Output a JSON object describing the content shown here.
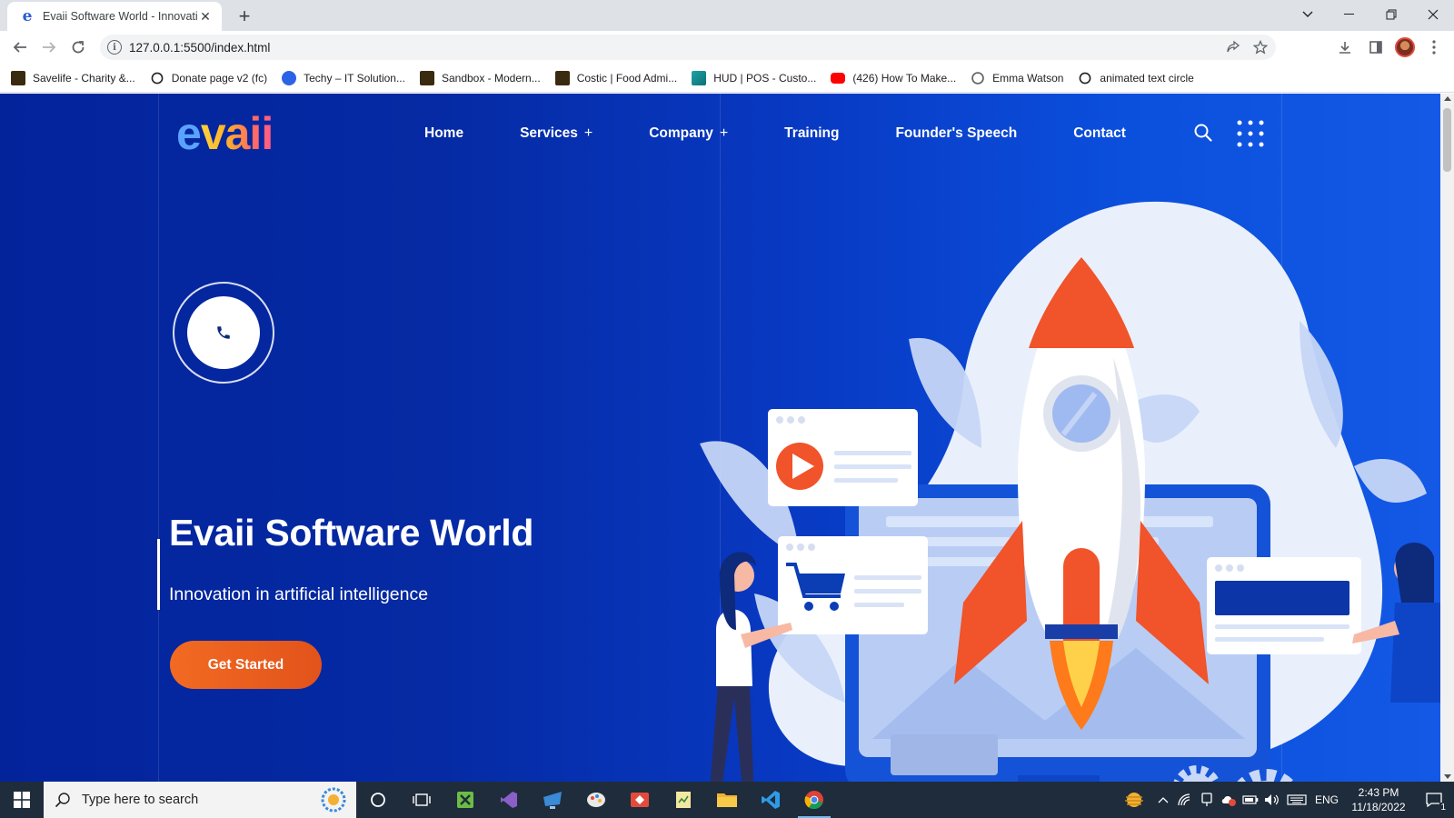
{
  "browser": {
    "tab_title": "Evaii Software World - Innovation in artificial intelligence",
    "tab_close": "✕",
    "new_tab": "+",
    "url": "127.0.0.1:5500/index.html",
    "bookmarks": [
      {
        "label": "Savelife - Charity &...",
        "icon_color": "#c9892b"
      },
      {
        "label": "Donate page v2 (fc)",
        "icon_color": "#202124"
      },
      {
        "label": "Techy – IT Solution...",
        "icon_color": "#2b63e6"
      },
      {
        "label": "Sandbox - Modern...",
        "icon_color": "#8b5a1e"
      },
      {
        "label": "Costic | Food Admi...",
        "icon_color": "#a86a1a"
      },
      {
        "label": "HUD | POS - Custo...",
        "icon_color": "#1aa3a8"
      },
      {
        "label": "(426) How To Make...",
        "icon_color": "#ff0000"
      },
      {
        "label": "Emma Watson",
        "icon_color": "#5f6368"
      },
      {
        "label": "animated text circle",
        "icon_color": "#202124"
      }
    ]
  },
  "site": {
    "logo": {
      "first": "e",
      "rest": "vaii"
    },
    "nav": [
      {
        "label": "Home",
        "has_submenu": false
      },
      {
        "label": "Services",
        "has_submenu": true
      },
      {
        "label": "Company",
        "has_submenu": true
      },
      {
        "label": "Training",
        "has_submenu": false
      },
      {
        "label": "Founder's Speech",
        "has_submenu": false
      },
      {
        "label": "Contact",
        "has_submenu": false
      }
    ],
    "submenu_marker": "+",
    "hero": {
      "title": "Evaii Software World",
      "subtitle": "Innovation in artificial intelligence",
      "cta_label": "Get Started"
    },
    "colors": {
      "hero_bg": "#052aa3",
      "accent": "#f26a22",
      "rocket_red": "#f1532a"
    }
  },
  "taskbar": {
    "search_placeholder": "Type here to search",
    "language": "ENG",
    "time": "2:43 PM",
    "date": "11/18/2022",
    "notification_count": "1"
  }
}
